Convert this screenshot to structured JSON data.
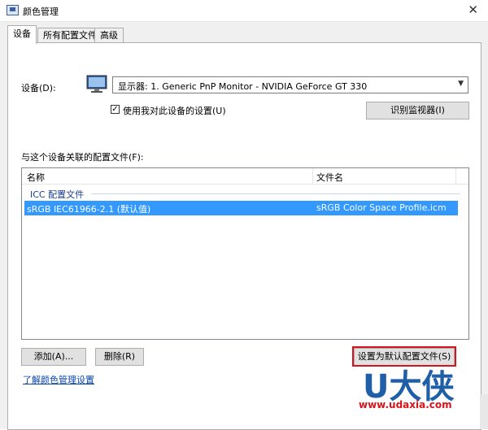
{
  "window": {
    "title": "颜色管理",
    "close_glyph": "✕"
  },
  "tabs": [
    {
      "label": "设备"
    },
    {
      "label": "所有配置文件"
    },
    {
      "label": "高级"
    }
  ],
  "device": {
    "label": "设备(D):",
    "selected": "显示器: 1. Generic PnP Monitor - NVIDIA GeForce GT 330",
    "use_settings_label": "使用我对此设备的设置(U)",
    "use_settings_checked": true,
    "identify_button": "识别监视器(I)"
  },
  "profiles": {
    "label": "与这个设备关联的配置文件(F):",
    "columns": [
      "名称",
      "文件名"
    ],
    "group_label": "ICC 配置文件",
    "rows": [
      {
        "name": "sRGB IEC61966-2.1 (默认值)",
        "file": "sRGB Color Space Profile.icm",
        "selected": true
      }
    ]
  },
  "buttons": {
    "add": "添加(A)...",
    "delete": "删除(R)",
    "set_default": "设置为默认配置文件(S)"
  },
  "link": {
    "text": "了解颜色管理设置"
  },
  "watermark": {
    "logo_text": "U大侠",
    "url": "www.udaxia.com"
  }
}
